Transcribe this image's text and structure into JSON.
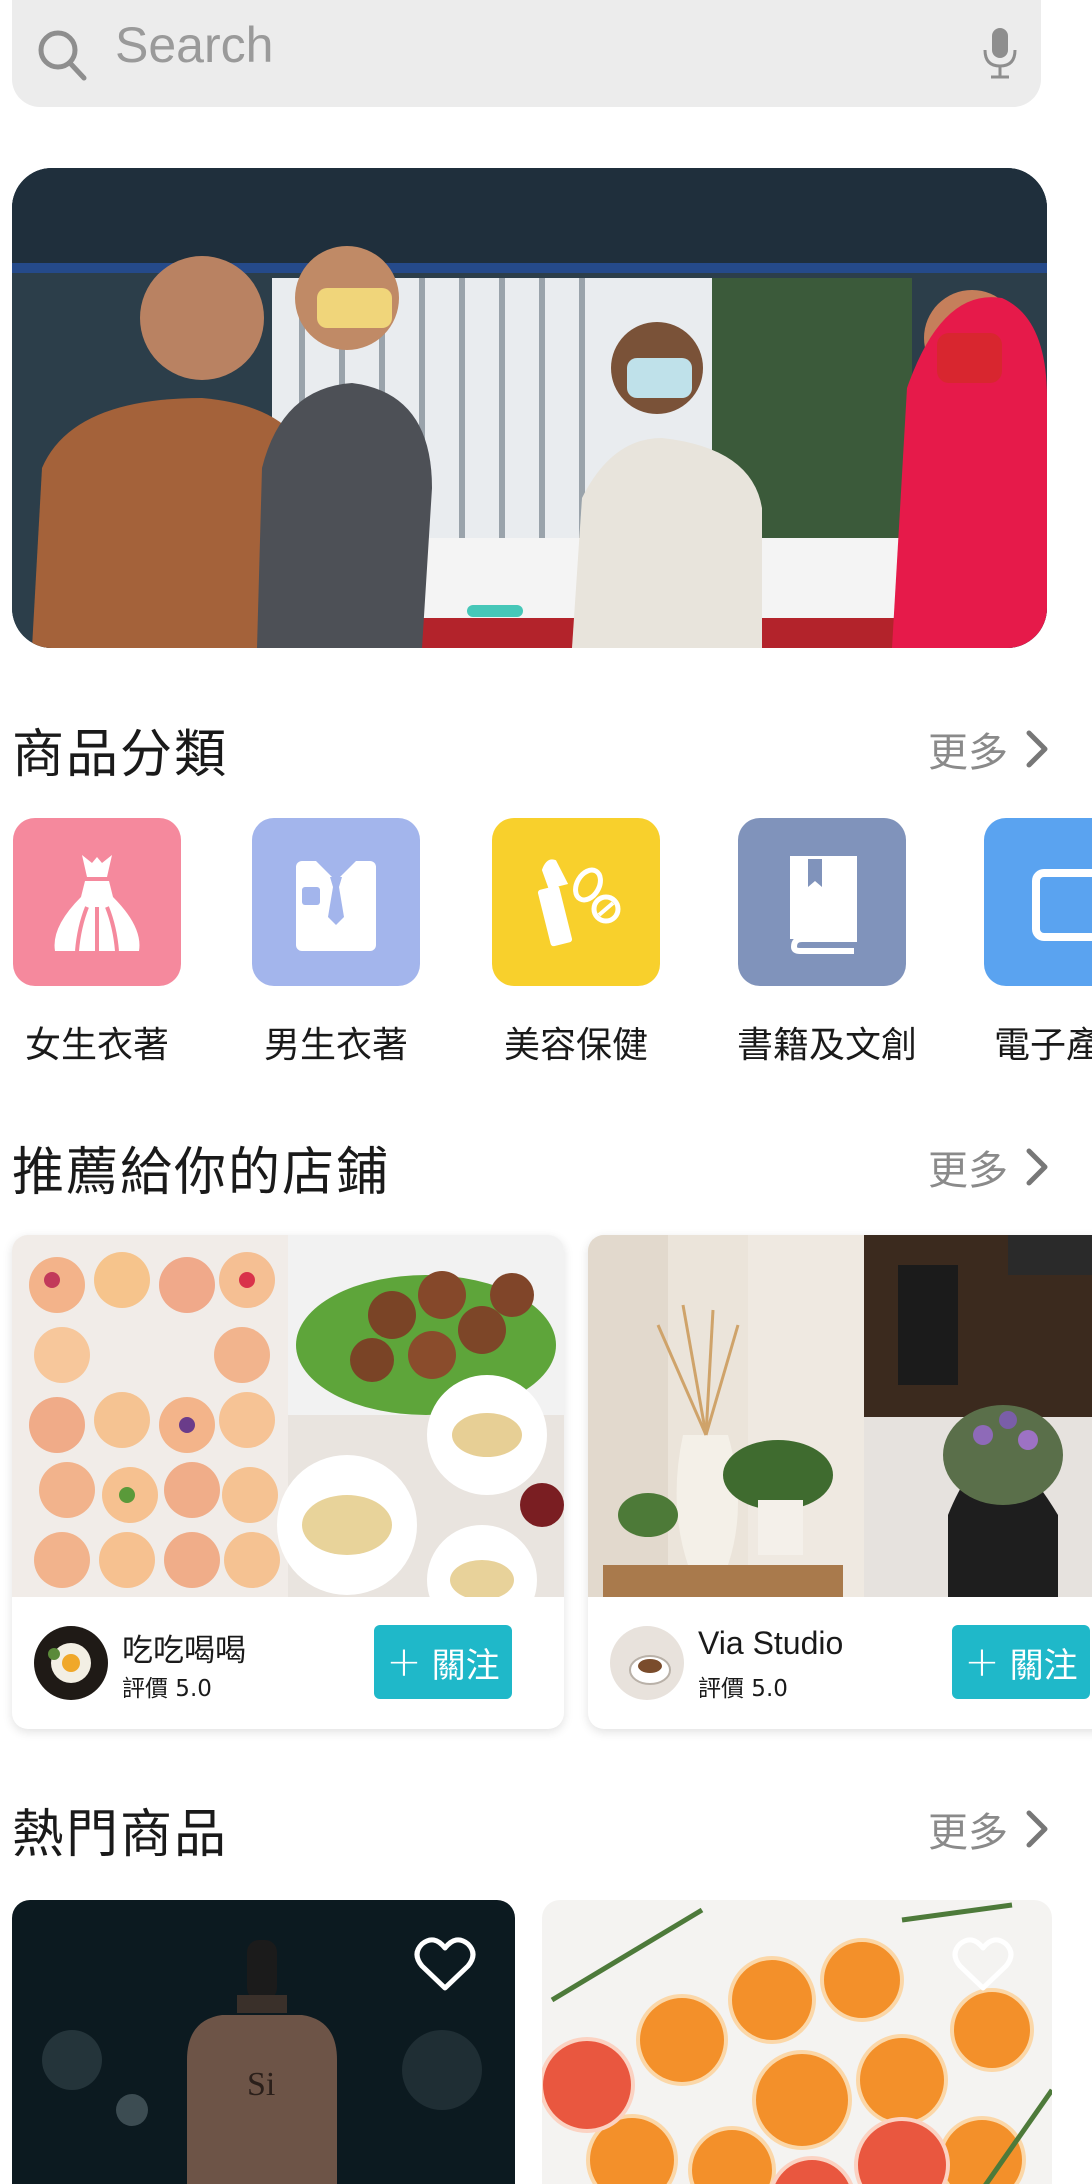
{
  "search": {
    "placeholder": "Search"
  },
  "sections": {
    "categories": {
      "title": "商品分類",
      "more": "更多"
    },
    "shops": {
      "title": "推薦給你的店鋪",
      "more": "更多"
    },
    "hot": {
      "title": "熱門商品",
      "more": "更多"
    }
  },
  "categories": [
    {
      "label": "女生衣著",
      "icon": "dress-icon",
      "color": "#f5899d"
    },
    {
      "label": "男生衣著",
      "icon": "shirt-icon",
      "color": "#a3b5ec"
    },
    {
      "label": "美容保健",
      "icon": "lipstick-pills-icon",
      "color": "#f8d02c"
    },
    {
      "label": "書籍及文創",
      "icon": "book-icon",
      "color": "#8093bb"
    },
    {
      "label": "電子產",
      "icon": "tablet-icon",
      "color": "#5aa3f0"
    }
  ],
  "shops": [
    {
      "name": "吃吃喝喝",
      "rating": "評價 5.0",
      "follow": "關注"
    },
    {
      "name": "Via Studio",
      "rating": "評價 5.0",
      "follow": "關注"
    }
  ],
  "colors": {
    "accent": "#1fb8c9",
    "indicator": "#46c7b8"
  }
}
